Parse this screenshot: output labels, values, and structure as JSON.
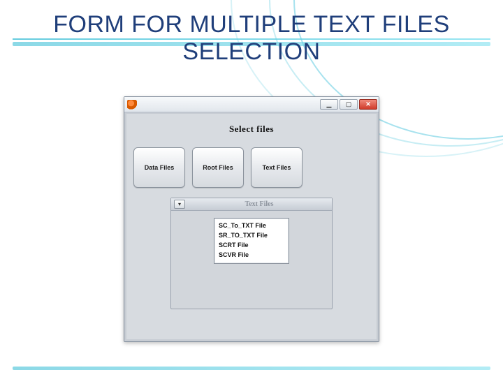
{
  "slide": {
    "title": "FORM FOR MULTIPLE TEXT FILES SELECTION"
  },
  "window": {
    "heading": "Select files",
    "buttons": {
      "data": "Data Files",
      "root": "Root Files",
      "text": "Text Files"
    },
    "internal_frame": {
      "title": "Text Files",
      "items": [
        "SC_To_TXT File",
        "SR_TO_TXT File",
        "SCRT File",
        "SCVR File"
      ]
    }
  }
}
